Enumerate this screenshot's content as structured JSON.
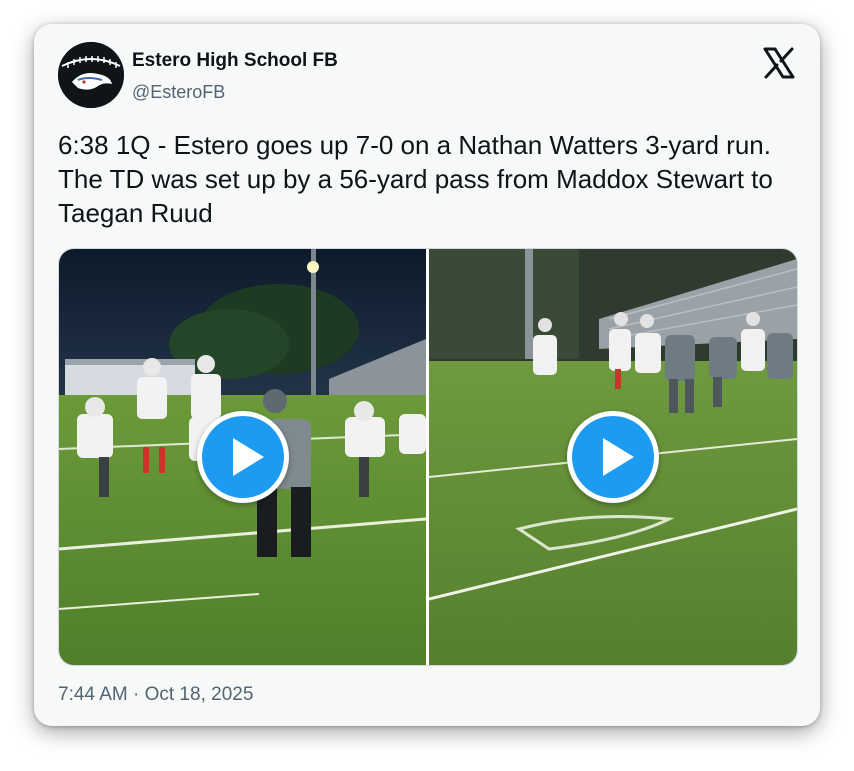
{
  "author": {
    "display_name": "Estero High School FB",
    "handle": "@EsteroFB",
    "avatar_icon": "estero-wildcat-logo-icon"
  },
  "platform_icon": "x-logo-icon",
  "tweet": {
    "text": "6:38 1Q - Estero goes up 7-0 on a Nathan Watters 3-yard run. The TD was set up by a 56-yard pass from Maddox Stewart to Taegan Ruud",
    "timestamp": "7:44 AM · Oct 18, 2025"
  },
  "media": {
    "videos": [
      {
        "id": "video-1",
        "play_icon": "play-icon"
      },
      {
        "id": "video-2",
        "play_icon": "play-icon"
      }
    ]
  },
  "colors": {
    "accent": "#1d9bf0",
    "text": "#0f1419",
    "secondary_text": "#536471",
    "card_bg": "#f7f9f9"
  }
}
